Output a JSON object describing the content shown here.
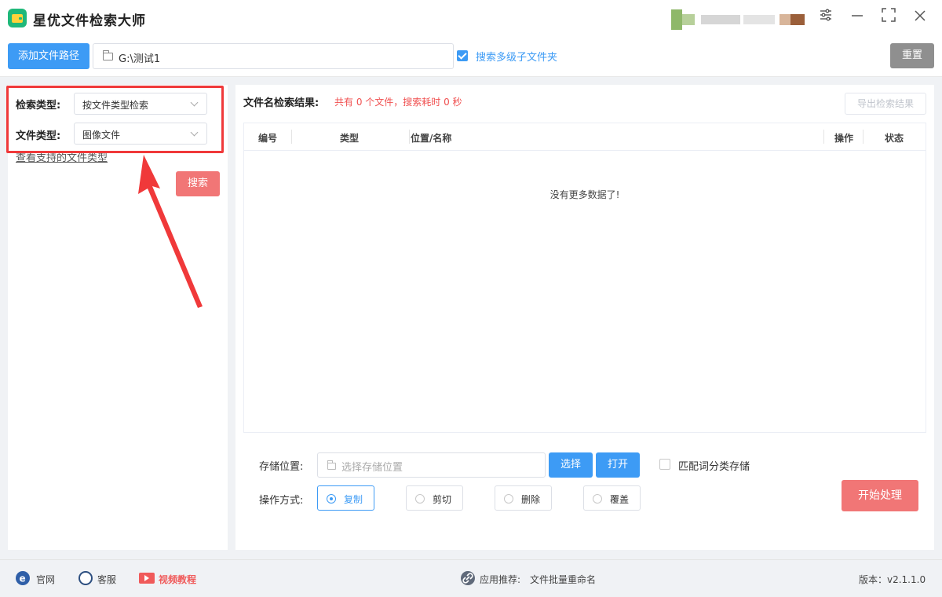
{
  "app": {
    "title": "星优文件检索大师",
    "accent": "#3d9bf5",
    "danger": "#f17676"
  },
  "window_controls": {
    "settings_icon": "sliders-icon",
    "minimize_icon": "minimize-icon",
    "maximize_icon": "maximize-icon",
    "close_icon": "close-icon"
  },
  "pathbar": {
    "add_path_label": "添加文件路径",
    "path_value": "G:\\测试1",
    "subfolder_checked": true,
    "subfolder_label": "搜索多级子文件夹",
    "reset_label": "重置"
  },
  "left": {
    "search_type_label": "检索类型:",
    "search_type_value": "按文件类型检索",
    "file_type_label": "文件类型:",
    "file_type_value": "图像文件",
    "supported_link": "查看支持的文件类型",
    "search_button": "搜索"
  },
  "results": {
    "title": "文件名检索结果:",
    "summary": "共有 0 个文件，搜索耗时 0 秒",
    "export_button": "导出检索结果",
    "columns": {
      "index": "编号",
      "type": "类型",
      "location": "位置/名称",
      "action": "操作",
      "status": "状态"
    },
    "empty": "没有更多数据了!"
  },
  "storage": {
    "label": "存储位置:",
    "placeholder": "选择存储位置",
    "choose_button": "选择",
    "open_button": "打开",
    "match_label": "匹配词分类存储"
  },
  "operation": {
    "label": "操作方式:",
    "options": [
      "复制",
      "剪切",
      "删除",
      "覆盖"
    ],
    "selected": "复制",
    "start_button": "开始处理"
  },
  "footer": {
    "website": "官网",
    "support": "客服",
    "tutorial": "视频教程",
    "recommend_label": "应用推荐:",
    "recommend_value": "文件批量重命名",
    "version": "版本：v2.1.1.0"
  }
}
